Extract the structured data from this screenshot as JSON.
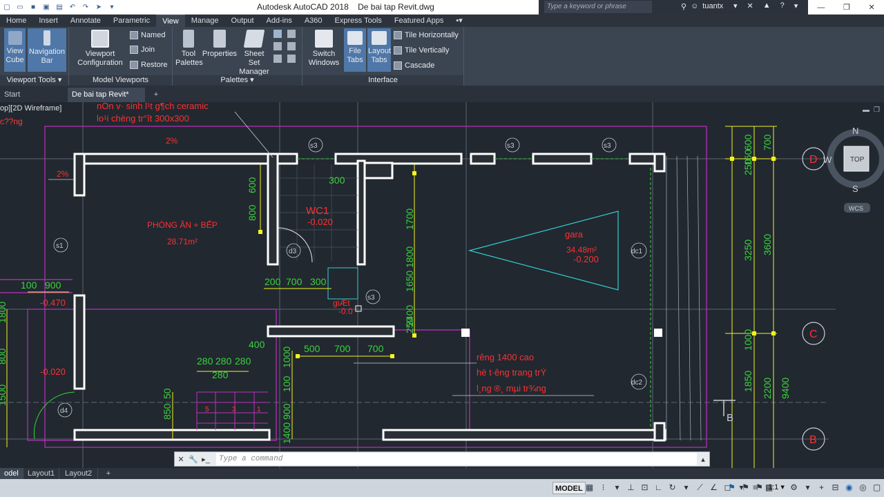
{
  "titlebar": {
    "app_title": "Autodesk AutoCAD 2018",
    "file_title": "De bai tap Revit.dwg",
    "search_placeholder": "Type a keyword or phrase",
    "username": "tuantx"
  },
  "menu": {
    "items": [
      "Home",
      "Insert",
      "Annotate",
      "Parametric",
      "View",
      "Manage",
      "Output",
      "Add-ins",
      "A360",
      "Express Tools",
      "Featured Apps"
    ],
    "active": "View"
  },
  "ribbon": {
    "viewport_tools": {
      "label": "Viewport Tools",
      "view_cube": "View Cube",
      "navigation_bar": "Navigation Bar"
    },
    "model_viewports": {
      "label": "Model Viewports",
      "viewport_configuration": "Viewport Configuration",
      "named": "Named",
      "join": "Join",
      "restore": "Restore"
    },
    "palettes": {
      "label": "Palettes",
      "tool_palettes": "Tool Palettes",
      "properties": "Properties",
      "sheet_set_manager": "Sheet Set Manager"
    },
    "interface": {
      "label": "Interface",
      "switch_windows": "Switch Windows",
      "file_tabs": "File Tabs",
      "layout_tabs": "Layout Tabs",
      "tile_horizontally": "Tile Horizontally",
      "tile_vertically": "Tile Vertically",
      "cascade": "Cascade"
    }
  },
  "file_tabs": {
    "start": "Start",
    "drawing": "De bai tap Revit*"
  },
  "viewport": {
    "label": "op][2D Wireframe]",
    "label_red": "c??ng",
    "viewcube": {
      "top": "TOP",
      "n": "N",
      "s": "S",
      "w": "W",
      "wcs": "WCS"
    }
  },
  "drawing_text": {
    "note1": "nÒn v· sinh l¹t g¶ch ceramic",
    "note2": "lo¹i chèng tr°ît 300x300",
    "slope1": "2%",
    "slope2": "2%",
    "kitchen": "PHÒNG ĂN + BẾP",
    "kitchen_area": "28.71m²",
    "wc": "WC1",
    "wc_level": "-0.020",
    "gara": "gara",
    "gara_area": "34.48m²",
    "gara_level": "-0.200",
    "level_left1": "-0.470",
    "level_left2": "-0.020",
    "giet": "giÆt",
    "giet_level": "-0.0",
    "note3": "rêng 1400 cao",
    "note4": "hë t·êng trang trÝ",
    "note5": "l¸ng ®¸ mµi tr¾ng",
    "dim_texts": [
      "100",
      "900",
      "300",
      "600",
      "800",
      "1700",
      "200",
      "700",
      "300",
      "500",
      "700",
      "700",
      "400",
      "280",
      "280",
      "280",
      "280",
      "1000",
      "850",
      "50",
      "900",
      "100",
      "1400",
      "1650",
      "1800",
      "2400",
      "250",
      "3250",
      "3600",
      "1000",
      "1850",
      "2200",
      "9400",
      "600",
      "700",
      "150",
      "250",
      "1500",
      "800",
      "1800"
    ],
    "grid_d": "D",
    "grid_c": "C",
    "grid_b": "B",
    "tag_s3a": "s3",
    "tag_s3b": "s3",
    "tag_s3c": "s3",
    "tag_s3d": "s3",
    "tag_s1": "s1",
    "tag_d3": "d3",
    "tag_d4": "d4",
    "tag_dc1": "dc1",
    "tag_dc2": "dc2",
    "stair_nums": [
      "5",
      "3",
      "1"
    ],
    "section_b": "B"
  },
  "command": {
    "placeholder": "Type a command"
  },
  "layout_tabs": [
    "odel",
    "Layout1",
    "Layout2"
  ],
  "status": {
    "model": "MODEL",
    "scale": "1:1"
  },
  "colors": {
    "wall": "#ffffff",
    "dim": "#f5f51e",
    "dim_text": "#3cd33c",
    "red_text": "#ff3030",
    "magenta": "#c030c0",
    "cyan": "#30d0d0",
    "grid_circle": "#ff3030"
  }
}
